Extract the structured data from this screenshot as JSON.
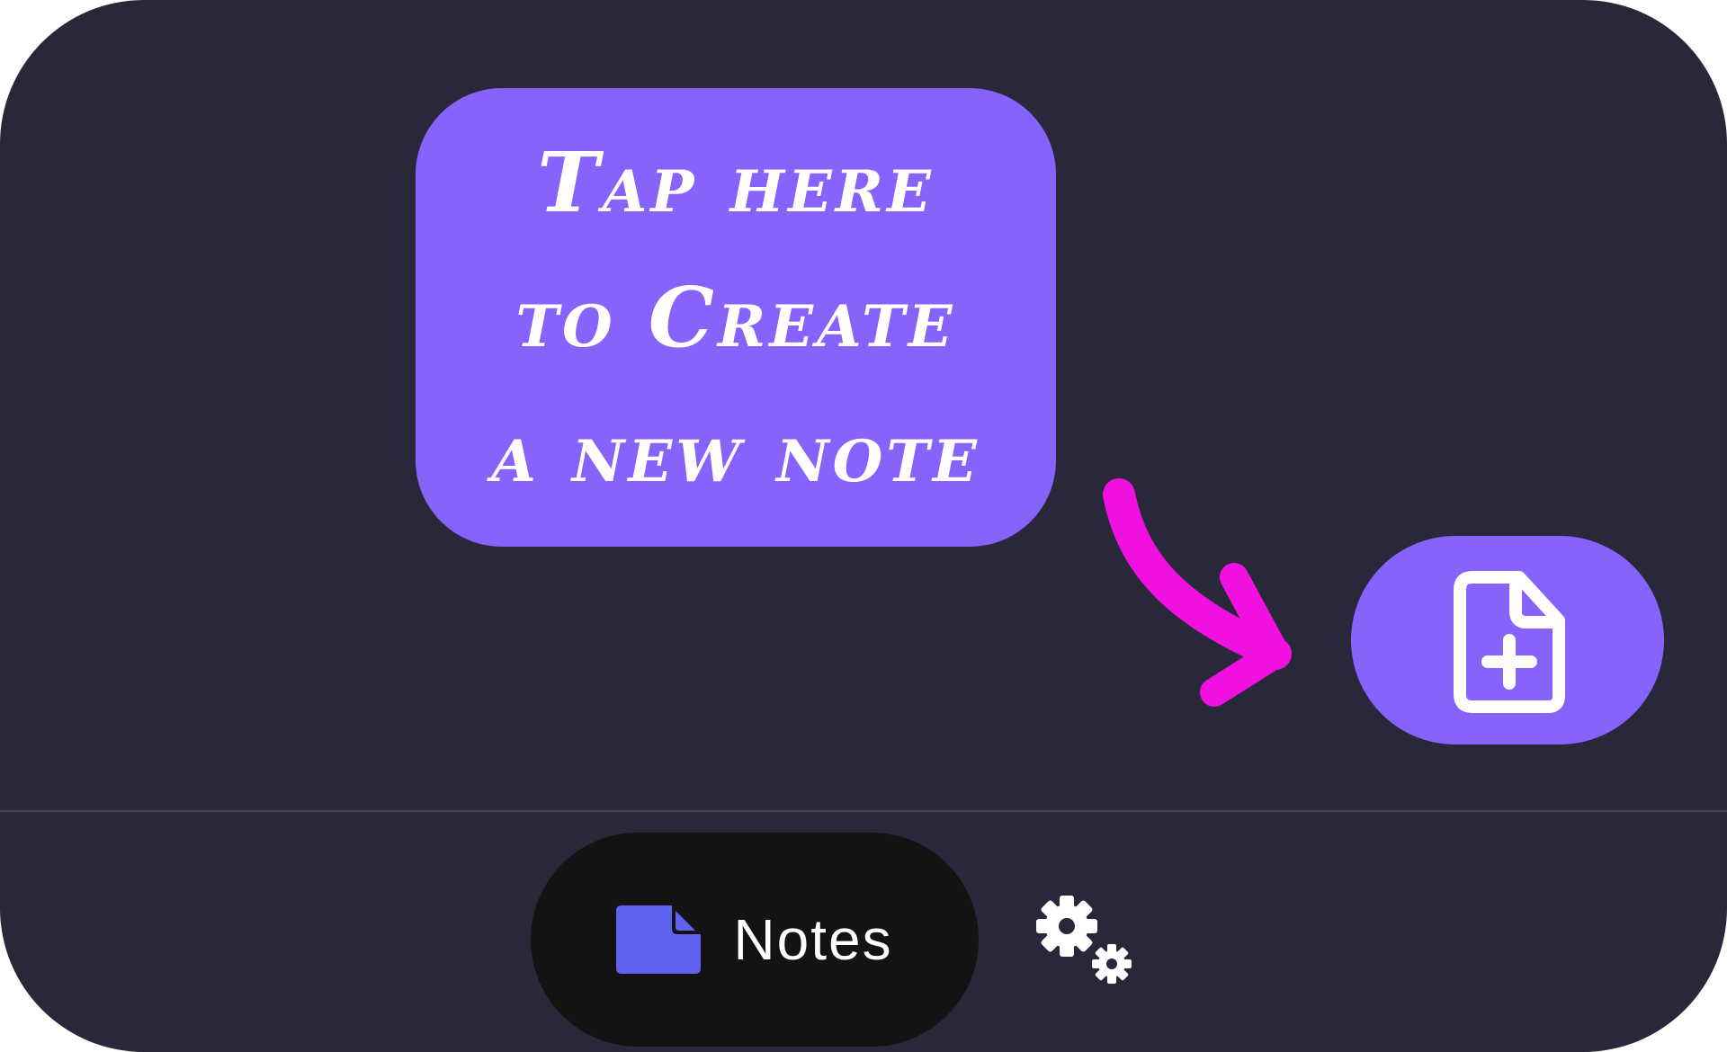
{
  "tooltip": {
    "lines": [
      "Tap here",
      "to Create",
      "a new note"
    ],
    "color": "#8762fb"
  },
  "arrow": {
    "icon": "curved-arrow-icon",
    "color": "#f010e0"
  },
  "fab": {
    "icon": "file-plus-icon",
    "color": "#8762fb"
  },
  "bottom_nav": {
    "items": [
      {
        "label": "Notes",
        "icon": "note-icon",
        "icon_color": "#6062f2",
        "active": true
      },
      {
        "label": "",
        "icon": "gears-icon",
        "active": false
      }
    ]
  },
  "theme": {
    "background": "#29283b",
    "active_pill": "#131313",
    "text": "#ffffff"
  }
}
